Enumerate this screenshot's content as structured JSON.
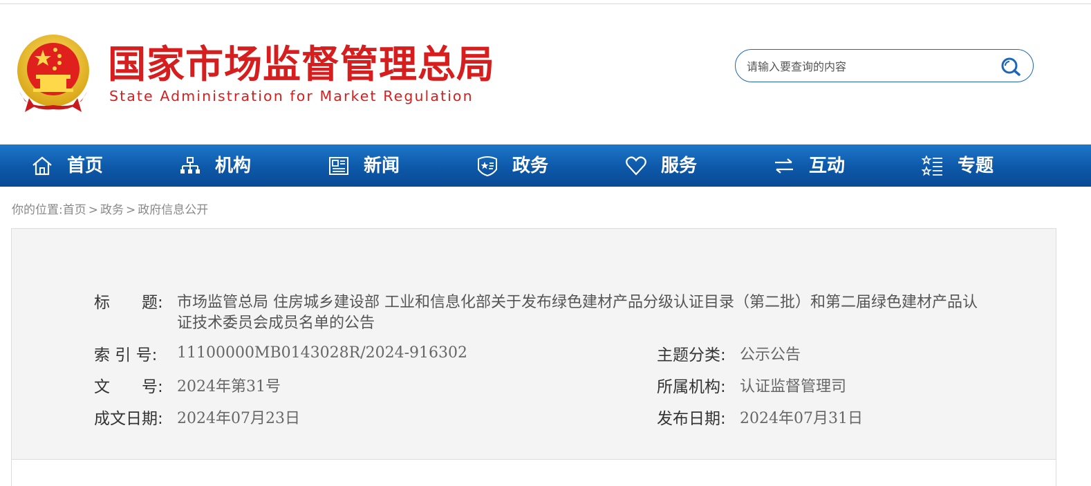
{
  "header": {
    "logo_cn": "国家市场监督管理总局",
    "logo_en": "State Administration for Market Regulation",
    "search_placeholder": "请输入要查询的内容"
  },
  "nav": {
    "items": [
      {
        "label": "首页",
        "icon": "home-icon"
      },
      {
        "label": "机构",
        "icon": "org-chart-icon"
      },
      {
        "label": "新闻",
        "icon": "news-icon"
      },
      {
        "label": "政务",
        "icon": "shield-star-icon"
      },
      {
        "label": "服务",
        "icon": "heart-icon"
      },
      {
        "label": "互动",
        "icon": "exchange-arrows-icon"
      },
      {
        "label": "专题",
        "icon": "star-list-icon"
      }
    ]
  },
  "breadcrumb": {
    "prefix": "你的位置:",
    "items": [
      "首页",
      "政务",
      "政府信息公开"
    ],
    "separator": ">"
  },
  "info": {
    "title_label": "标　　题:",
    "title_value": "市场监管总局 住房城乡建设部 工业和信息化部关于发布绿色建材产品分级认证目录（第二批）和第二届绿色建材产品认证技术委员会成员名单的公告",
    "index_label": "索 引 号:",
    "index_value": "11100000MB0143028R/2024-916302",
    "topic_label": "主题分类:",
    "topic_value": "公示公告",
    "docno_label": "文　　号:",
    "docno_value": "2024年第31号",
    "org_label": "所属机构:",
    "org_value": "认证监督管理司",
    "written_label": "成文日期:",
    "written_value": "2024年07月23日",
    "publish_label": "发布日期:",
    "publish_value": "2024年07月31日"
  },
  "colors": {
    "brand_red": "#d71e1e",
    "nav_blue": "#0d58a8",
    "search_border": "#1b66b8"
  }
}
